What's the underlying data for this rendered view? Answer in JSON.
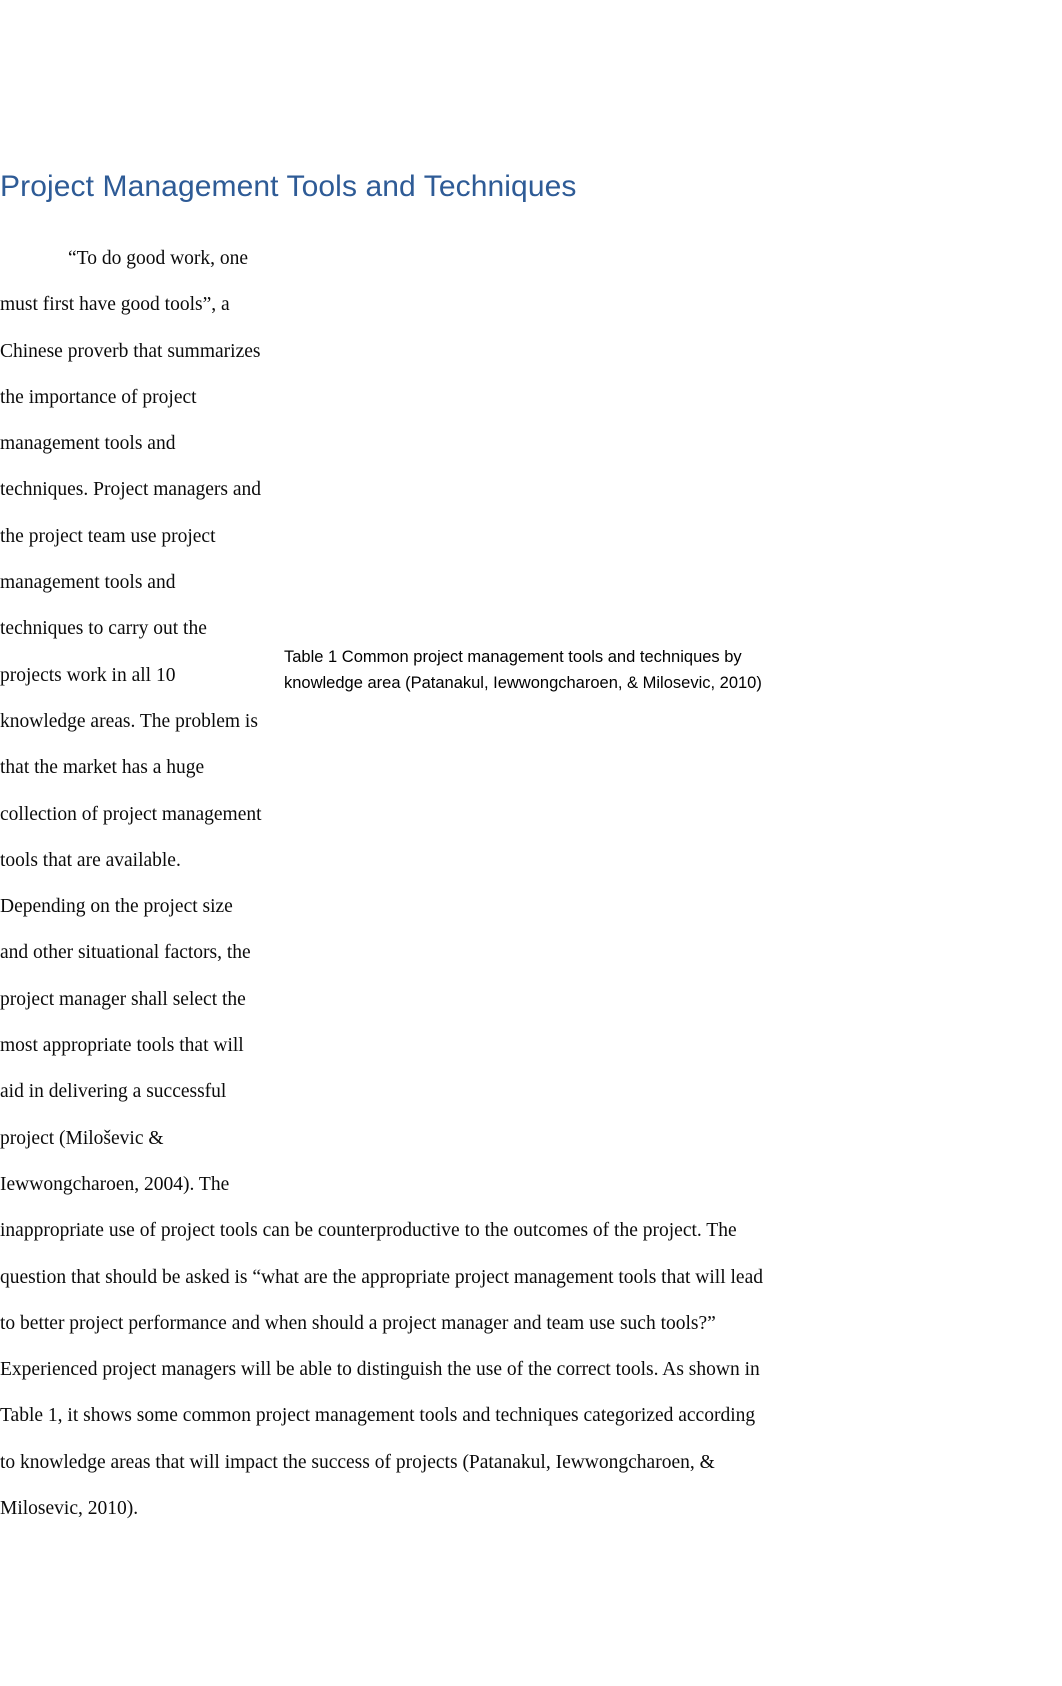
{
  "document": {
    "heading": "Project Management Tools and Techniques",
    "heading_color": "#2e5b96",
    "body_text_color": "#0b0b0b",
    "page_background": "#ffffff",
    "body_paragraph": "“To do good work, one must first have good tools”, a Chinese proverb that summarizes the importance of project management tools and techniques. Project managers and the project team use project management tools and techniques to carry out the projects work in all 10 knowledge areas. The problem is that the market has a huge collection of project management tools that are available. Depending on the project size and other situational factors, the project manager shall select the most appropriate tools that will aid in delivering a successful project (Miloševic & Iewwongcharoen, 2004). The inappropriate use of project tools can be counterproductive to the outcomes of the project. The question that should be asked is “what are the appropriate project management tools that will lead to better project performance and when should a project manager and team use such tools?” Experienced project managers will be able to distinguish the use of the correct tools. As shown in Table 1, it shows some common project management tools and techniques categorized according to knowledge areas that will impact the success of projects (Patanakul, Iewwongcharoen, & Milosevic, 2010).",
    "table": {
      "caption": "Table 1 Common project management tools and techniques by knowledge area (Patanakul, Iewwongcharoen, & Milosevic, 2010)",
      "content_note": ""
    }
  }
}
